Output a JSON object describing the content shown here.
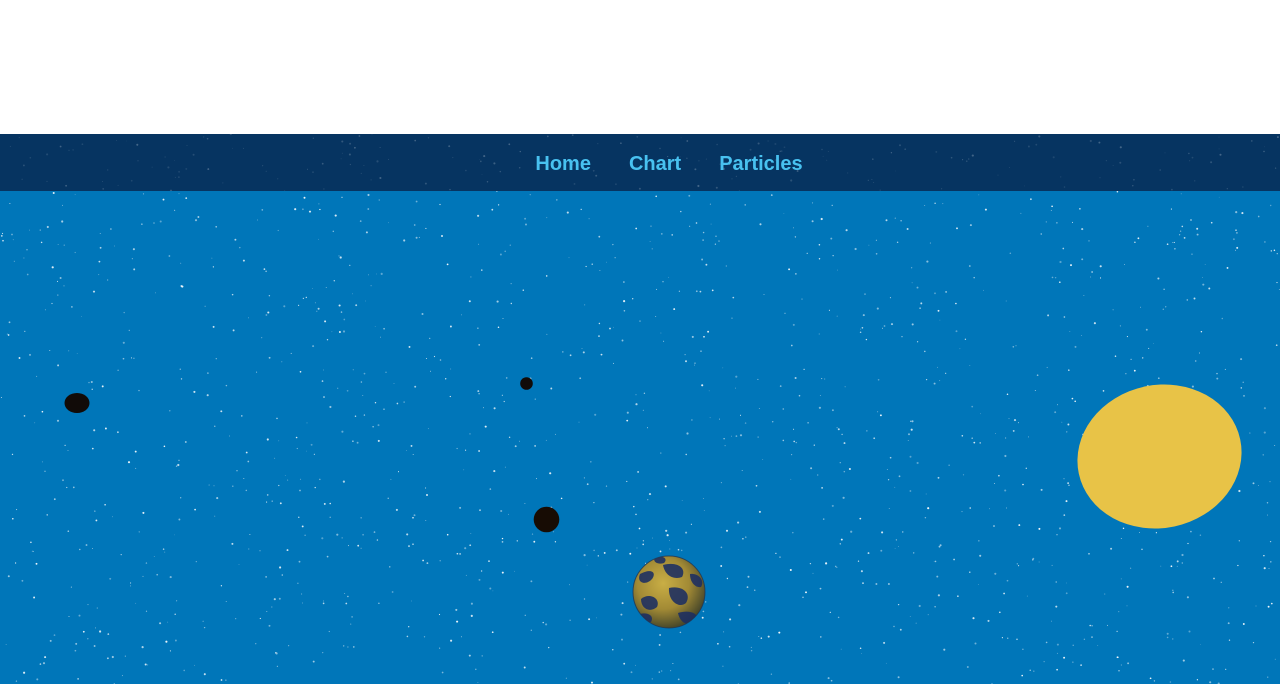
{
  "nav": {
    "items": [
      {
        "label": "Home"
      },
      {
        "label": "Chart"
      },
      {
        "label": "Particles"
      }
    ]
  },
  "colors": {
    "header_background": "#ffffff",
    "navbar_background": "#063461",
    "nav_link": "#48c1f0",
    "space_background": "#0076b9",
    "sun": "#e8c347",
    "dark_body": "#110b08",
    "textured_planet_base": "#a28a35",
    "textured_planet_spots": "#1c2e62",
    "stars": "#ffffff"
  },
  "scene": {
    "celestial_bodies": [
      {
        "name": "small-dark-moon-left",
        "kind": "dark-body"
      },
      {
        "name": "small-dark-moon-center",
        "kind": "dark-body"
      },
      {
        "name": "dark-planet",
        "kind": "dark-body"
      },
      {
        "name": "textured-planet",
        "kind": "textured-planet"
      },
      {
        "name": "sun",
        "kind": "sun"
      }
    ],
    "starfield": {
      "kind": "white-dot-stars"
    }
  }
}
